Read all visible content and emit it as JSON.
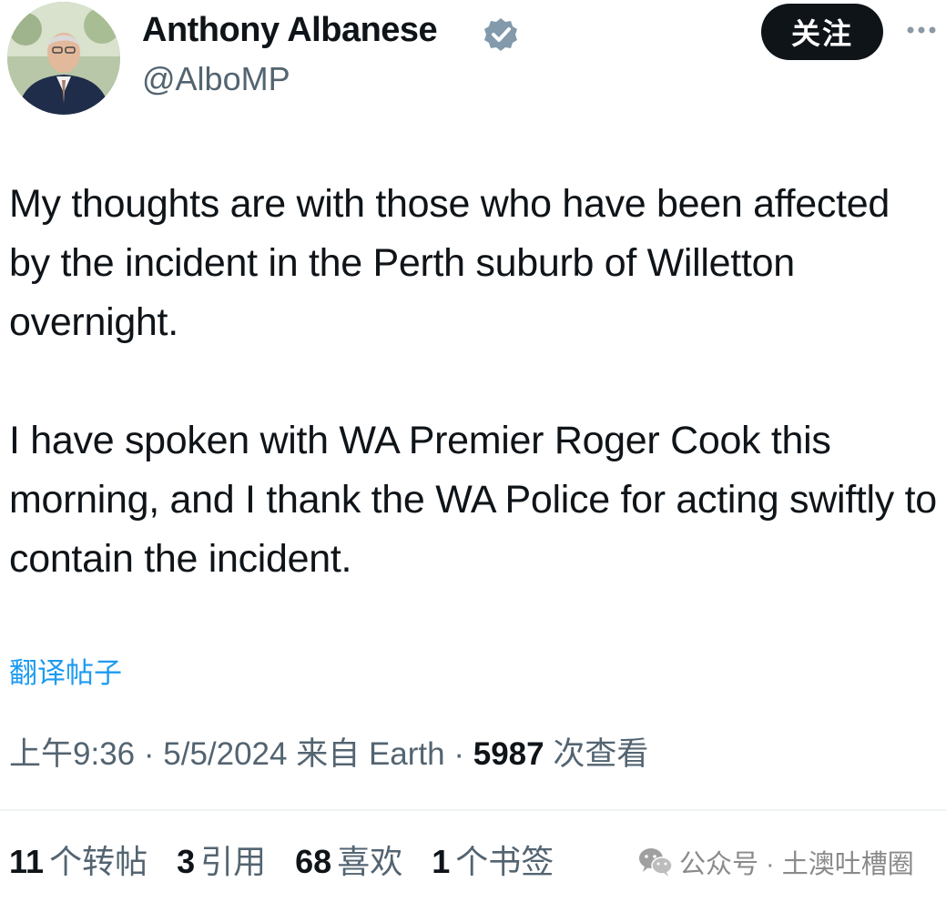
{
  "author": {
    "display_name": "Anthony Albanese",
    "handle": "@AlboMP",
    "verified_icon": "verified-badge-icon",
    "avatar_icon": "profile-photo"
  },
  "actions": {
    "follow_label": "关注",
    "more_icon": "more-options-icon"
  },
  "tweet": {
    "paragraphs": [
      "My thoughts are with those who have been affected by the incident in the Perth suburb of Willetton overnight.",
      "I have spoken with WA Premier Roger Cook this morning, and I thank the WA Police for acting swiftly to contain the incident."
    ],
    "translate_label": "翻译帖子"
  },
  "meta": {
    "time": "上午9:36",
    "date": "5/5/2024",
    "source": "来自 Earth",
    "separator": "·",
    "views_count": "5987",
    "views_label": "次查看"
  },
  "stats": [
    {
      "count": "11",
      "label": "个转帖"
    },
    {
      "count": "3",
      "label": "引用"
    },
    {
      "count": "68",
      "label": "喜欢"
    },
    {
      "count": "1",
      "label": "个书签"
    }
  ],
  "watermark": {
    "icon": "wechat-icon",
    "text": "公众号 · 土澳吐槽圈"
  },
  "colors": {
    "link": "#1d9bf0",
    "secondary_text": "#536471",
    "primary_text": "#0f1419",
    "verified": "#829aab",
    "button_bg": "#0f1419"
  }
}
